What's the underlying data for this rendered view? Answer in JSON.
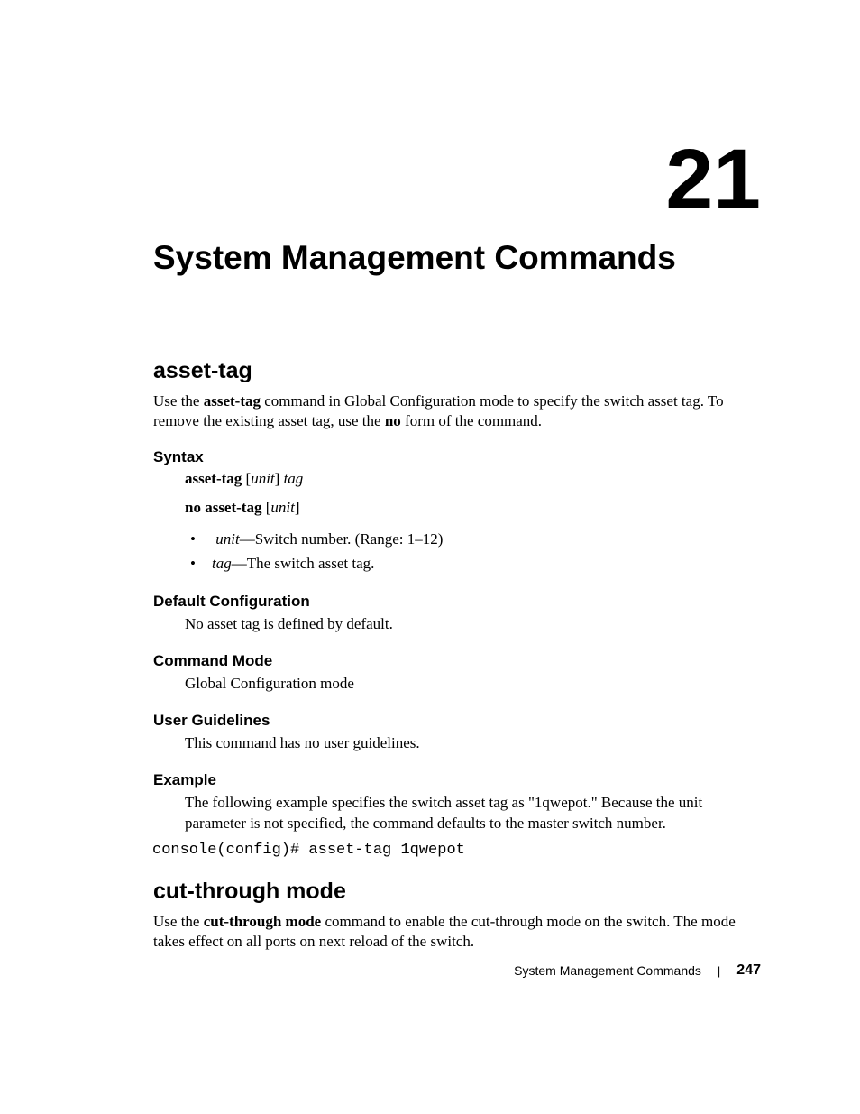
{
  "chapter": {
    "number": "21",
    "title": "System Management Commands"
  },
  "sections": [
    {
      "title": "asset-tag",
      "intro_parts": [
        "Use the ",
        "asset-tag",
        " command in Global Configuration mode to specify the switch asset tag. To remove the existing asset tag, use the ",
        "no",
        " form of the command."
      ],
      "syntax": {
        "heading": "Syntax",
        "line1": {
          "cmd": "asset-tag",
          "bracket_open": " [",
          "param1": "unit",
          "bracket_close": "] ",
          "param2": "tag"
        },
        "line2": {
          "cmd": "no asset-tag",
          "bracket_open": " [",
          "param1": "unit",
          "bracket_close": "]"
        },
        "params": [
          {
            "name": "unit",
            "desc": "—Switch number. (Range: 1–12)"
          },
          {
            "name": "tag",
            "desc": "—The switch asset tag."
          }
        ]
      },
      "default_config": {
        "heading": "Default Configuration",
        "body": "No asset tag is defined by default."
      },
      "command_mode": {
        "heading": "Command Mode",
        "body": "Global Configuration mode"
      },
      "user_guidelines": {
        "heading": "User Guidelines",
        "body": "This command has no user guidelines."
      },
      "example": {
        "heading": "Example",
        "body": "The following example specifies the switch asset tag as \"1qwepot.\" Because the unit parameter is not specified, the command defaults to the master switch number.",
        "code": "console(config)# asset-tag 1qwepot"
      }
    },
    {
      "title": "cut-through mode",
      "intro_parts": [
        "Use the ",
        "cut-through mode",
        " command to enable the cut-through mode on the switch. The mode takes effect on all ports on next reload of the switch."
      ]
    }
  ],
  "footer": {
    "text": "System Management Commands",
    "divider": "|",
    "page": "247"
  }
}
